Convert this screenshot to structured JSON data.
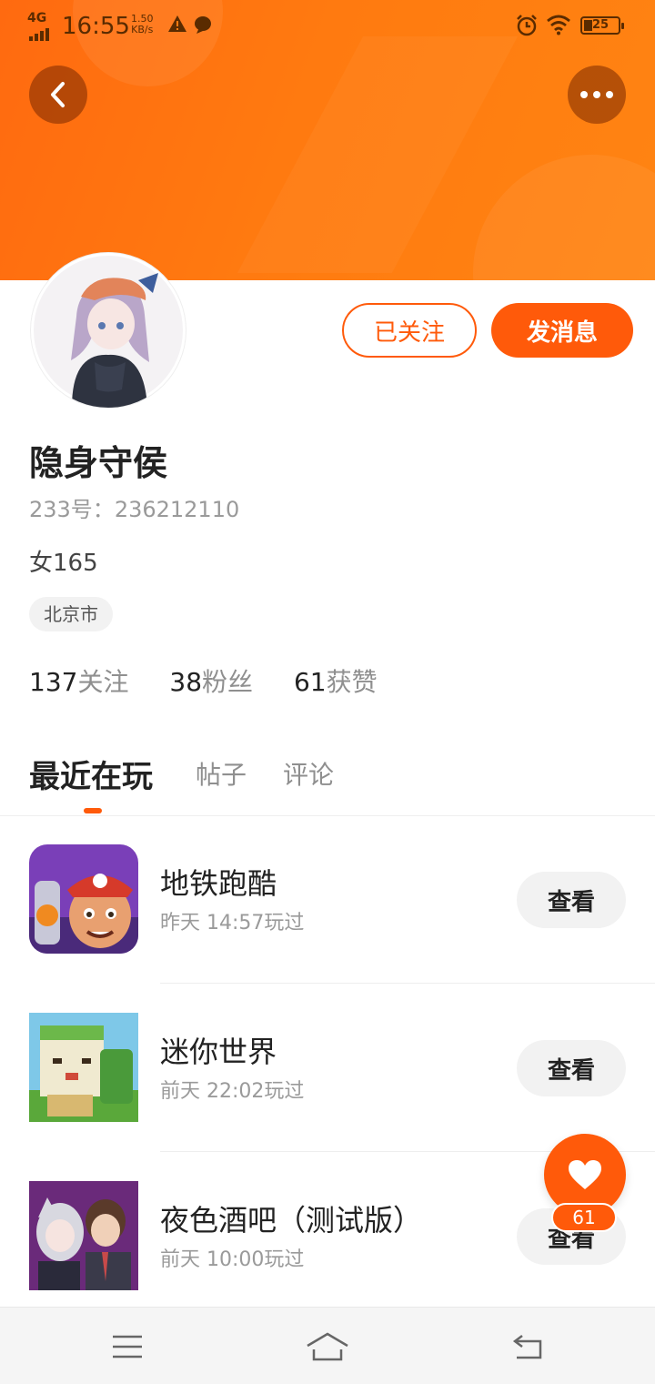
{
  "status_bar": {
    "network": "4G",
    "time": "16:55",
    "speed_value": "1.50",
    "speed_unit": "KB/s",
    "battery": "25",
    "icons": [
      "signal-icon",
      "warning-icon",
      "message-icon",
      "alarm-icon",
      "wifi-icon",
      "battery-icon"
    ]
  },
  "header": {
    "back_icon": "chevron-left-icon",
    "more_icon": "more-dots-icon",
    "colors": {
      "accent": "#ff5a0a",
      "header_start": "#ff6a10",
      "header_end": "#ff8412"
    }
  },
  "profile": {
    "name": "隐身守侯",
    "id_label": "233号：",
    "id_value": "236212110",
    "bio": "女165",
    "location": "北京市",
    "follow_button": "已关注",
    "message_button": "发消息",
    "stats": [
      {
        "num": "137",
        "label": "关注"
      },
      {
        "num": "38",
        "label": "粉丝"
      },
      {
        "num": "61",
        "label": "获赞"
      }
    ]
  },
  "tabs": [
    {
      "label": "最近在玩",
      "active": true
    },
    {
      "label": "帖子",
      "active": false
    },
    {
      "label": "评论",
      "active": false
    }
  ],
  "games": [
    {
      "name": "地铁跑酷",
      "time": "昨天 14:57玩过",
      "button": "查看"
    },
    {
      "name": "迷你世界",
      "time": "前天 22:02玩过",
      "button": "查看"
    },
    {
      "name": "夜色酒吧（测试版）",
      "time": "前天 10:00玩过",
      "button": "查看"
    }
  ],
  "fab": {
    "icon": "heart-icon",
    "count": "61"
  },
  "nav_bar": {
    "icons": [
      "menu-icon",
      "home-icon",
      "back-icon"
    ]
  }
}
